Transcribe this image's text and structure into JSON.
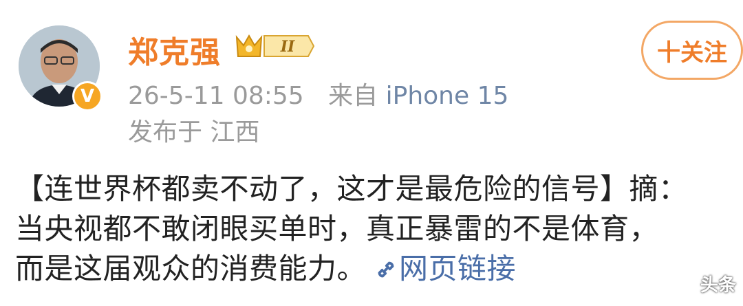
{
  "post": {
    "author": "郑克强",
    "follow_label": "十关注",
    "datetime": "26-5-11 08:55",
    "source_prefix": "来自",
    "device": "iPhone 15",
    "location": "发布于 江西",
    "badge_text": "II",
    "content_lines": [
      "【连世界杯都卖不动了，这才是最危险的信号】摘：",
      "当央视都不敢闭眼买单时，真正暴雷的不是体育，",
      "而是这届观众的消费能力。"
    ],
    "web_link_label": "网页链接"
  },
  "watermark": "头条",
  "colors": {
    "brand_orange": "#ef7d2a",
    "link_blue": "#4a6ea8",
    "meta_gray": "#9a9a9a"
  }
}
